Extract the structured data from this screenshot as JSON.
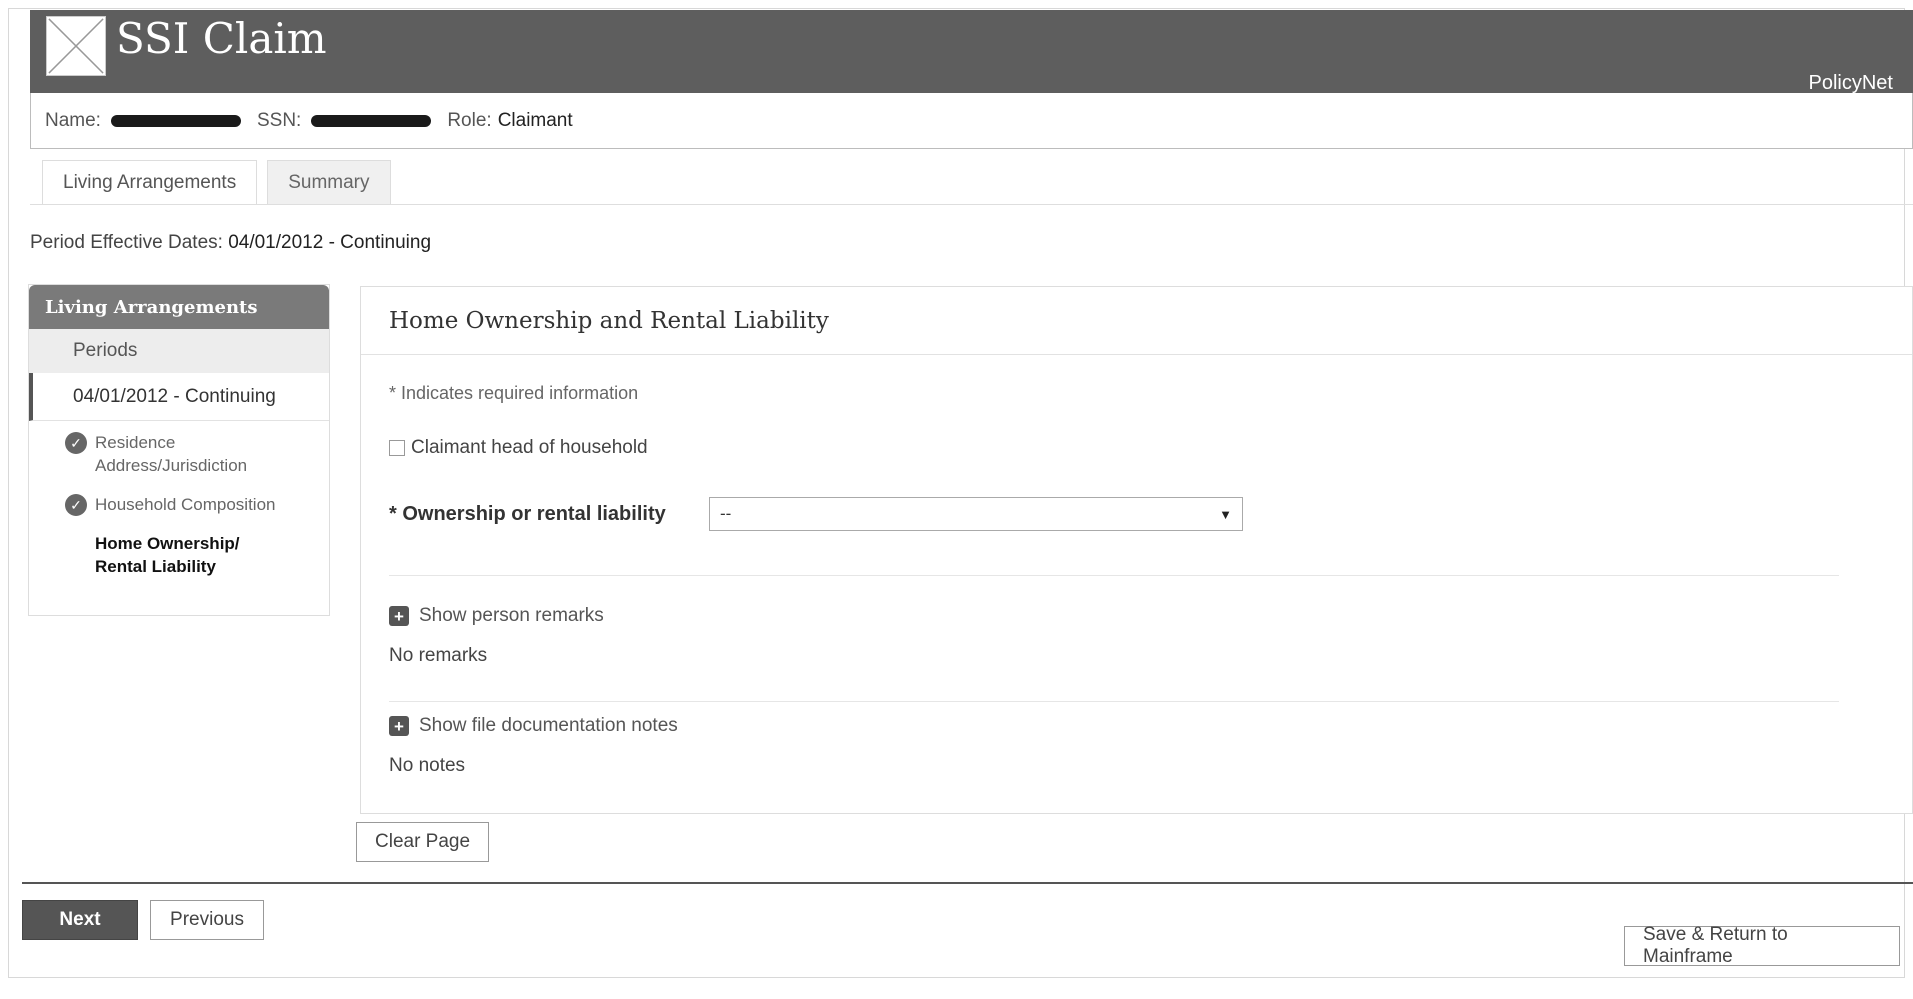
{
  "header": {
    "app_title": "SSI Claim",
    "brand": "PolicyNet"
  },
  "claimant_bar": {
    "name_label": "Name:",
    "ssn_label": "SSN:",
    "role_label": "Role:",
    "role_value": "Claimant"
  },
  "tabs": [
    {
      "label": "Living Arrangements"
    },
    {
      "label": "Summary"
    }
  ],
  "period": {
    "label": "Period Effective Dates:",
    "value": "04/01/2012 - Continuing"
  },
  "sidebar": {
    "heading": "Living Arrangements",
    "subheading": "Periods",
    "period_item": "04/01/2012 - Continuing",
    "steps": [
      {
        "label": "Residence Address/Jurisdiction",
        "icon": "check-circle-icon"
      },
      {
        "label": "Household Composition",
        "icon": "check-circle-icon"
      },
      {
        "label": "Home Ownership/ Rental Liability",
        "icon": ""
      }
    ]
  },
  "panel": {
    "title": "Home Ownership and Rental Liability",
    "required_note": "* Indicates required information",
    "checkbox_label": "Claimant head of household",
    "field_label": "* Ownership or rental liability",
    "select_value": "--",
    "person_remarks_toggle": "Show person remarks",
    "person_remarks_value": "No remarks",
    "file_notes_toggle": "Show file documentation notes",
    "file_notes_value": "No notes"
  },
  "buttons": {
    "clear": "Clear Page",
    "next": "Next",
    "previous": "Previous",
    "save_return": "Save & Return to Mainframe"
  },
  "icons": {
    "logo": "placeholder-image-icon",
    "expand": "plus-square-icon",
    "dropdown": "caret-down-icon"
  }
}
